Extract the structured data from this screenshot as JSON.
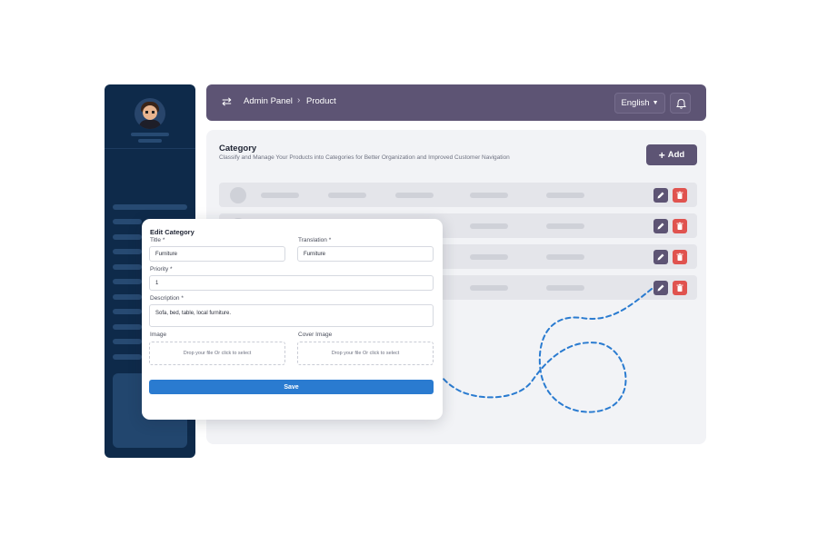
{
  "header": {
    "breadcrumb": [
      "Admin Panel",
      "Product"
    ],
    "language": "English",
    "menu_icon": "swap-arrows-icon",
    "notification_icon": "bell-icon"
  },
  "sidebar": {
    "avatar_icon": "user-avatar"
  },
  "main": {
    "title": "Category",
    "subtitle": "Classify and Manage Your Products into Categories for Better Organization and Improved Customer Navigation",
    "add_label": "Add",
    "row_actions": [
      "edit-icon",
      "trash-icon"
    ]
  },
  "modal": {
    "title": "Edit Category",
    "fields": {
      "title": {
        "label": "Title *",
        "value": "Furniture"
      },
      "translation": {
        "label": "Translation *",
        "value": "Furniture"
      },
      "priority": {
        "label": "Priority *",
        "value": "1"
      },
      "description": {
        "label": "Description *",
        "value": "Sofa, bed, table, local furniture."
      },
      "image": {
        "label": "Image",
        "placeholder": "Drop your file Or click to select"
      },
      "cover_image": {
        "label": "Cover Image",
        "placeholder": "Drop your file Or click to select"
      }
    },
    "save_label": "Save"
  },
  "colors": {
    "sidebar": "#0e2a4a",
    "header": "#5d5474",
    "primary_button": "#2a7bd0",
    "delete": "#e0534f"
  }
}
